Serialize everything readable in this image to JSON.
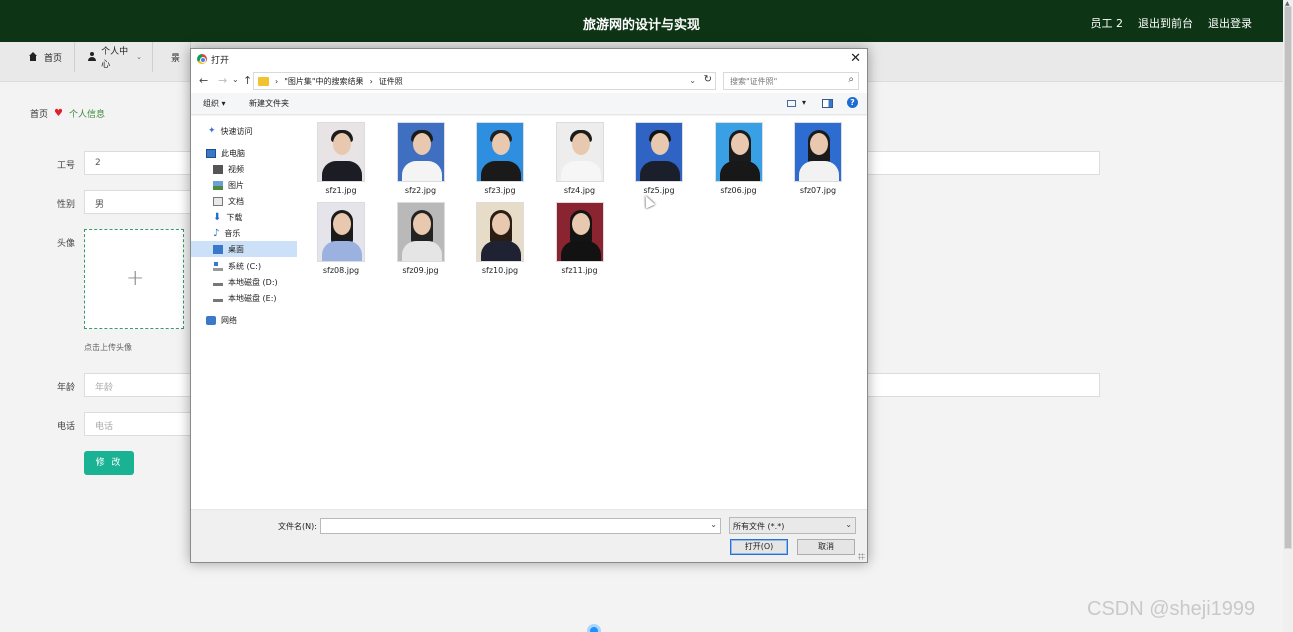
{
  "header": {
    "title": "旅游网的设计与实现",
    "links": [
      "员工 2",
      "退出到前台",
      "退出登录"
    ]
  },
  "nav": {
    "items": [
      {
        "label": "首页",
        "icon": "home-icon"
      },
      {
        "label": "个人中心",
        "icon": "user-icon"
      },
      {
        "label": "景",
        "icon": "grid-icon"
      }
    ]
  },
  "breadcrumb": {
    "home": "首页",
    "sep": "♥",
    "current": "个人信息"
  },
  "form": {
    "id_label": "工号",
    "id_value": "2",
    "gender_label": "性别",
    "gender_value": "男",
    "avatar_label": "头像",
    "avatar_plus": "+",
    "avatar_tip": "点击上传头像",
    "age_label": "年龄",
    "age_placeholder": "年龄",
    "phone_label": "电话",
    "phone_placeholder": "电话",
    "submit_label": "修 改"
  },
  "dialog": {
    "title": "打开",
    "close": "✕",
    "nav": {
      "back": "←",
      "forward": "→",
      "down": "⌄",
      "up": "↑"
    },
    "address": {
      "sep": "›",
      "part1": "\"图片集\"中的搜索结果",
      "part2": "证件照",
      "arrow": "⌄",
      "refresh": "↻"
    },
    "search_placeholder": "搜索\"证件照\"",
    "toolbar": {
      "organize": "组织 ▾",
      "new_folder": "新建文件夹",
      "view_arrow": "▾",
      "help": "?"
    },
    "sidebar": [
      {
        "label": "快速访问",
        "icon": "pin-icon",
        "selected": false
      },
      {
        "label": "此电脑",
        "icon": "computer-icon",
        "selected": false
      },
      {
        "label": "视频",
        "icon": "video-folder-icon",
        "selected": false
      },
      {
        "label": "图片",
        "icon": "pictures-folder-icon",
        "selected": false
      },
      {
        "label": "文档",
        "icon": "documents-folder-icon",
        "selected": false
      },
      {
        "label": "下载",
        "icon": "download-icon",
        "selected": false
      },
      {
        "label": "音乐",
        "icon": "music-icon",
        "selected": false
      },
      {
        "label": "桌面",
        "icon": "desktop-icon",
        "selected": true
      },
      {
        "label": "系统 (C:)",
        "icon": "system-drive-icon",
        "selected": false
      },
      {
        "label": "本地磁盘 (D:)",
        "icon": "disk-icon",
        "selected": false
      },
      {
        "label": "本地磁盘 (E:)",
        "icon": "disk-icon",
        "selected": false
      },
      {
        "label": "网络",
        "icon": "network-icon",
        "selected": false
      }
    ],
    "files": [
      {
        "name": "sfz1.jpg",
        "bg": "#e8e4e6",
        "hair": "#1b1b1b",
        "long": false,
        "cloth": "#1c1c24"
      },
      {
        "name": "sfz2.jpg",
        "bg": "#3f6fc0",
        "hair": "#1b1b1b",
        "long": false,
        "cloth": "#f4f4f4"
      },
      {
        "name": "sfz3.jpg",
        "bg": "#2e8ee0",
        "hair": "#222222",
        "long": false,
        "cloth": "#1a1a1a"
      },
      {
        "name": "sfz4.jpg",
        "bg": "#ededed",
        "hair": "#1b1b1b",
        "long": false,
        "cloth": "#f6f6f6"
      },
      {
        "name": "sfz5.jpg",
        "bg": "#2f63c4",
        "hair": "#141414",
        "long": false,
        "cloth": "#1b1f2c"
      },
      {
        "name": "sfz06.jpg",
        "bg": "#3aa0e6",
        "hair": "#1b1b1b",
        "long": true,
        "cloth": "#181818"
      },
      {
        "name": "sfz07.jpg",
        "bg": "#2d6cd0",
        "hair": "#1b1b1b",
        "long": true,
        "cloth": "#f2f2f2"
      },
      {
        "name": "sfz08.jpg",
        "bg": "#e4e4ea",
        "hair": "#1b1b1b",
        "long": true,
        "cloth": "#9bb2e0"
      },
      {
        "name": "sfz09.jpg",
        "bg": "#b9b9b9",
        "hair": "#222222",
        "long": true,
        "cloth": "#e5e5e5"
      },
      {
        "name": "sfz10.jpg",
        "bg": "#e6dcc8",
        "hair": "#2a1e14",
        "long": true,
        "cloth": "#1f2233"
      },
      {
        "name": "sfz11.jpg",
        "bg": "#8a2430",
        "hair": "#141414",
        "long": true,
        "cloth": "#121212"
      }
    ],
    "filename_label": "文件名(N):",
    "filename_value": "",
    "filetype_value": "所有文件 (*.*)",
    "open_button": "打开(O)",
    "cancel_button": "取消"
  },
  "watermark": "CSDN @sheji1999",
  "colors": {
    "header_bg": "#0d3515",
    "accent": "#19b394",
    "selection": "#cce1f7"
  }
}
